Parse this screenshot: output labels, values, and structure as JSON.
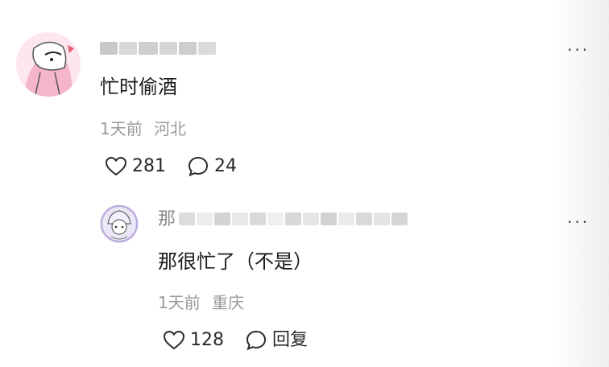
{
  "comments": [
    {
      "username_visible": "",
      "content": "忙时偷酒",
      "time": "1天前",
      "location": "河北",
      "likes": "281",
      "replies": "24",
      "more": "···"
    },
    {
      "username_visible": "那",
      "content": "那很忙了（不是）",
      "time": "1天前",
      "location": "重庆",
      "likes": "128",
      "reply_label": "回复",
      "more": "···"
    }
  ],
  "icons": {
    "like": "heart-outline-icon",
    "comment": "speech-bubble-icon",
    "more": "ellipsis-icon"
  },
  "colors": {
    "text_primary": "#1b1b1b",
    "text_secondary": "#9a9a9a"
  }
}
